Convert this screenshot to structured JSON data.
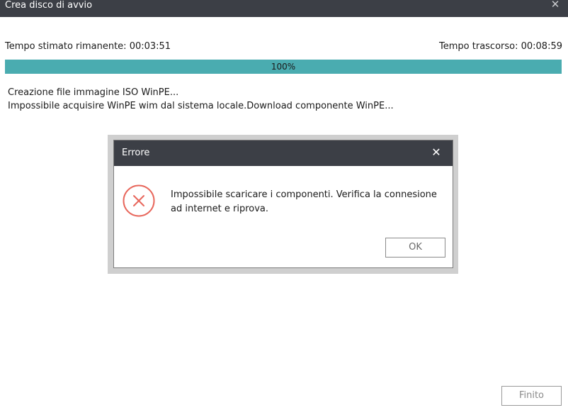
{
  "window": {
    "title": "Crea disco di avvio",
    "close_icon": "close-icon"
  },
  "times": {
    "remaining": "Tempo stimato rimanente: 00:03:51",
    "elapsed": "Tempo trascorso: 00:08:59"
  },
  "progress": {
    "value": 100,
    "label": "100%",
    "color": "#4aacb0"
  },
  "log": {
    "lines": [
      "Creazione file immagine ISO WinPE...",
      "Impossibile acquisire WinPE wim dal sistema locale.Download componente WinPE..."
    ]
  },
  "dialog": {
    "title": "Errore",
    "icon": "error-x-icon",
    "icon_color": "#e8675c",
    "message": "Impossibile scaricare i componenti. Verifica la connesione ad internet e riprova.",
    "ok_label": "OK"
  },
  "footer": {
    "finish_label": "Finito"
  }
}
